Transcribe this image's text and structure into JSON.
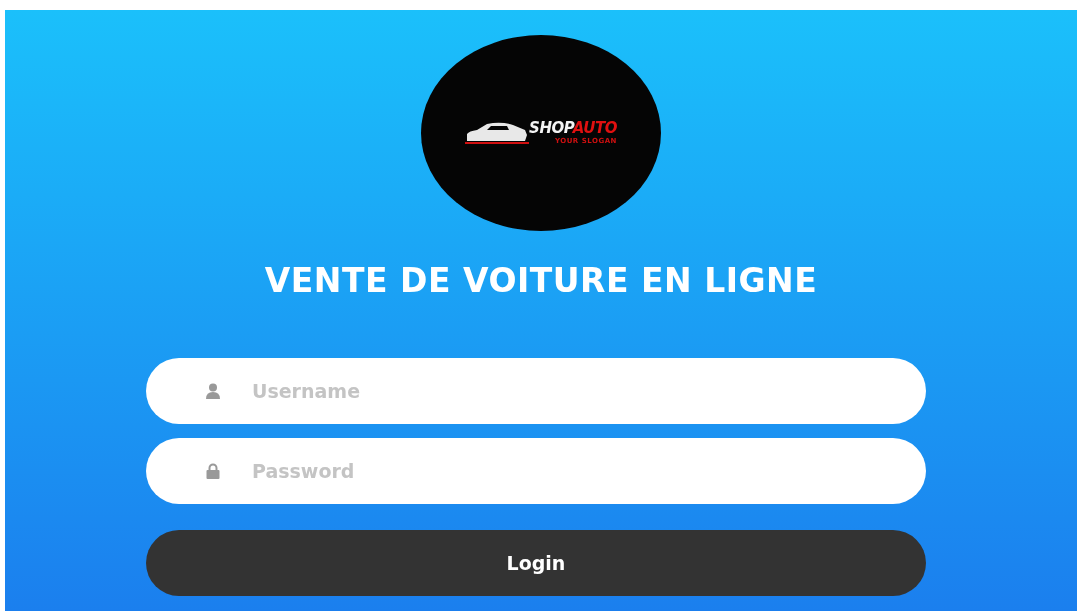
{
  "logo": {
    "brand_first": "SHOP",
    "brand_second": "AUTO",
    "slogan": "YOUR SLOGAN"
  },
  "title": "VENTE DE VOITURE EN LIGNE",
  "fields": [
    {
      "kind": "user",
      "placeholder": "Username"
    },
    {
      "kind": "lock",
      "placeholder": "Password"
    }
  ],
  "button": "Login"
}
